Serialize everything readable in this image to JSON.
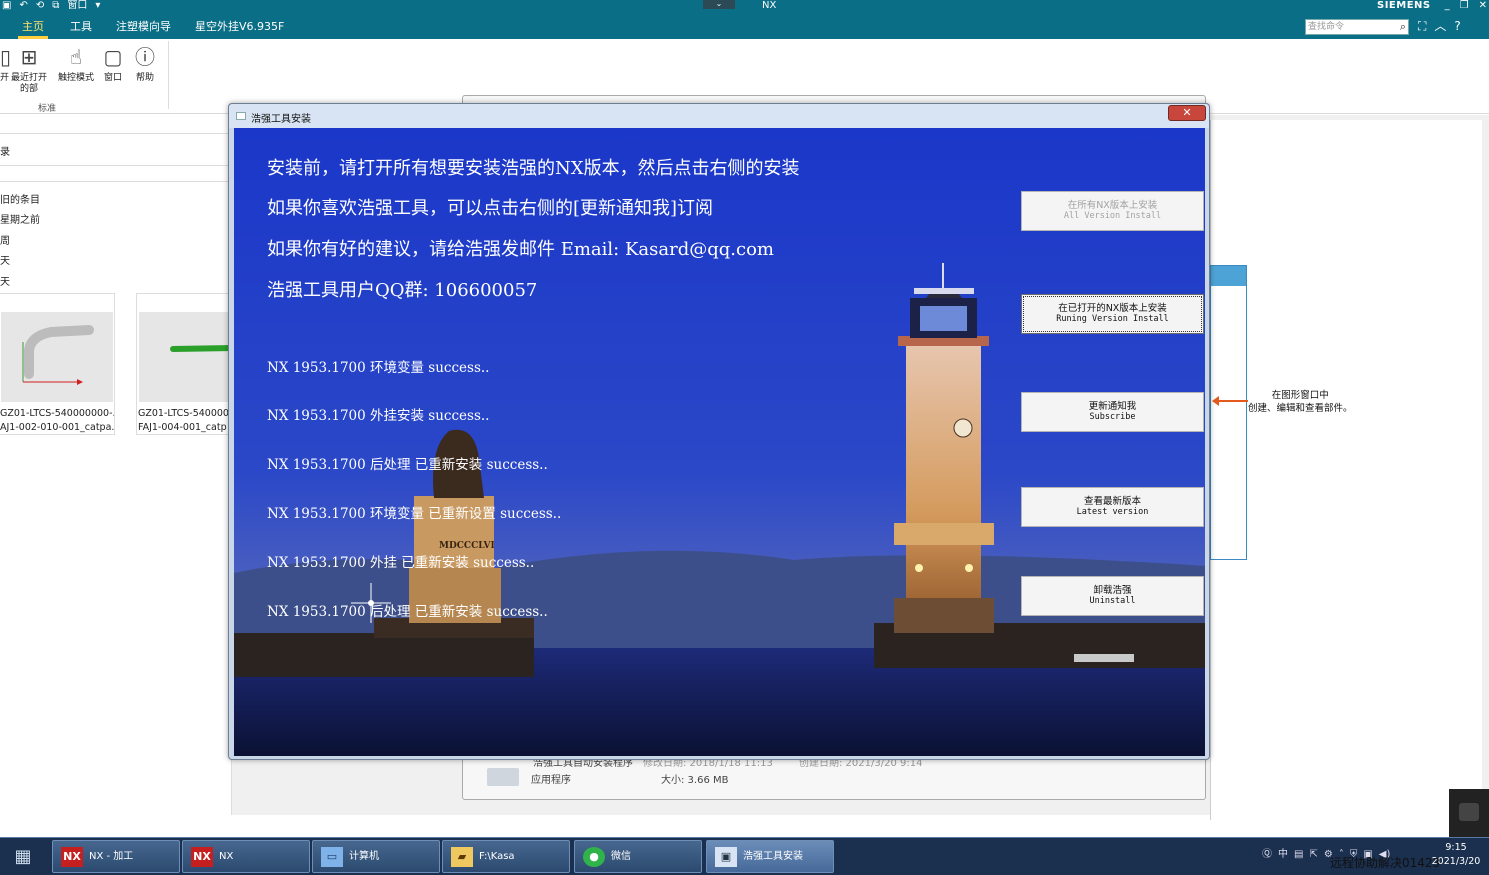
{
  "titlebar": {
    "window_menu": "窗口",
    "app_title": "NX",
    "brand": "SIEMENS"
  },
  "ribbon": {
    "tabs": [
      "主页",
      "工具",
      "注塑模向导",
      "星空外挂V6.935F"
    ],
    "active_tab": "主页",
    "search_placeholder": "查找命令",
    "buttons": [
      {
        "label": "最近打开的部",
        "icon": "recent-files-icon"
      },
      {
        "label": "触控模式",
        "icon": "touch-mode-icon"
      },
      {
        "label": "窗口",
        "icon": "window-icon"
      },
      {
        "label": "帮助",
        "icon": "help-icon"
      }
    ],
    "group_label": "标准"
  },
  "left_panel": {
    "header": "录",
    "items": [
      "旧的条目",
      "星期之前",
      "周",
      "天",
      "天"
    ],
    "thumbnails": [
      {
        "line1": "GZ01-LTCS-540000000-...",
        "line2": "AJ1-002-010-001_catpa..."
      },
      {
        "line1": "GZ01-LTCS-540000",
        "line2": "FAJ1-004-001_catp"
      }
    ]
  },
  "bg_window": {
    "file_name": "浩强工具自动安装程序",
    "modified": "修改日期: 2018/1/18 11:13",
    "created": "创建日期: 2021/3/20 9:14",
    "type": "应用程序",
    "size": "大小: 3.66 MB"
  },
  "hint": {
    "line1": "在图形窗口中",
    "line2": "创建、编辑和查看部件。"
  },
  "installer": {
    "title": "浩强工具安装",
    "messages": [
      "安装前，请打开所有想要安装浩强的NX版本，然后点击右侧的安装",
      "如果你喜欢浩强工具，可以点击右侧的[更新通知我]订阅",
      "如果你有好的建议，请给浩强发邮件 Email: Kasard@qq.com",
      "浩强工具用户QQ群: 106600057"
    ],
    "log": [
      "NX 1953.1700 环境变量 success..",
      "NX 1953.1700 外挂安装 success..",
      "NX 1953.1700 后处理 已重新安装 success..",
      "NX 1953.1700 环境变量 已重新设置 success..",
      "NX 1953.1700 外挂 已重新安装 success..",
      "NX 1953.1700 后处理 已重新安装 success.."
    ],
    "statue_inscription": "MDCCCLVI",
    "buttons": [
      {
        "cn": "在所有NX版本上安装",
        "en": "All Version Install",
        "state": "disabled"
      },
      {
        "cn": "在已打开的NX版本上安装",
        "en": "Runing Version Install",
        "state": "focused"
      },
      {
        "cn": "更新通知我",
        "en": "Subscribe",
        "state": "normal"
      },
      {
        "cn": "查看最新版本",
        "en": "Latest version",
        "state": "normal"
      },
      {
        "cn": "卸载浩强",
        "en": "Uninstall",
        "state": "normal"
      }
    ]
  },
  "taskbar": {
    "items": [
      {
        "label": "NX - 加工",
        "icon": "NX"
      },
      {
        "label": "NX",
        "icon": "NX"
      },
      {
        "label": "计算机",
        "icon": "computer-icon"
      },
      {
        "label": "F:\\Kasa",
        "icon": "folder-icon"
      },
      {
        "label": "微信",
        "icon": "wechat-icon"
      },
      {
        "label": "浩强工具安装",
        "icon": "installer-icon"
      }
    ],
    "active_item": "浩强工具安装",
    "tray_lang": "中",
    "time": "9:15",
    "date": "2021/3/20",
    "remote_text": "远程协助解决01423"
  }
}
